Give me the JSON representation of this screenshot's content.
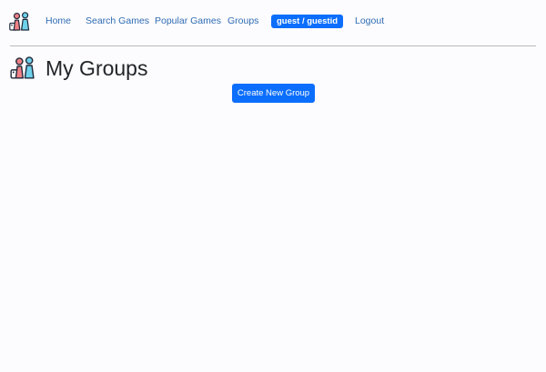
{
  "nav": {
    "logo_icon": "board-game-pieces-icon",
    "links": [
      {
        "label": "Home"
      },
      {
        "label": "Search Games"
      },
      {
        "label": "Popular Games"
      },
      {
        "label": "Groups"
      }
    ],
    "user_badge": "guest / guestid",
    "logout_label": "Logout"
  },
  "page": {
    "title": "My Groups",
    "title_icon": "board-game-pieces-icon",
    "create_group_label": "Create New Group"
  },
  "colors": {
    "accent": "#0b6efd",
    "link": "#2f6db5",
    "background": "#fcfbfd",
    "piece_red": "#ef8186",
    "piece_blue": "#6fd1ea",
    "outline": "#1f2a3a"
  }
}
